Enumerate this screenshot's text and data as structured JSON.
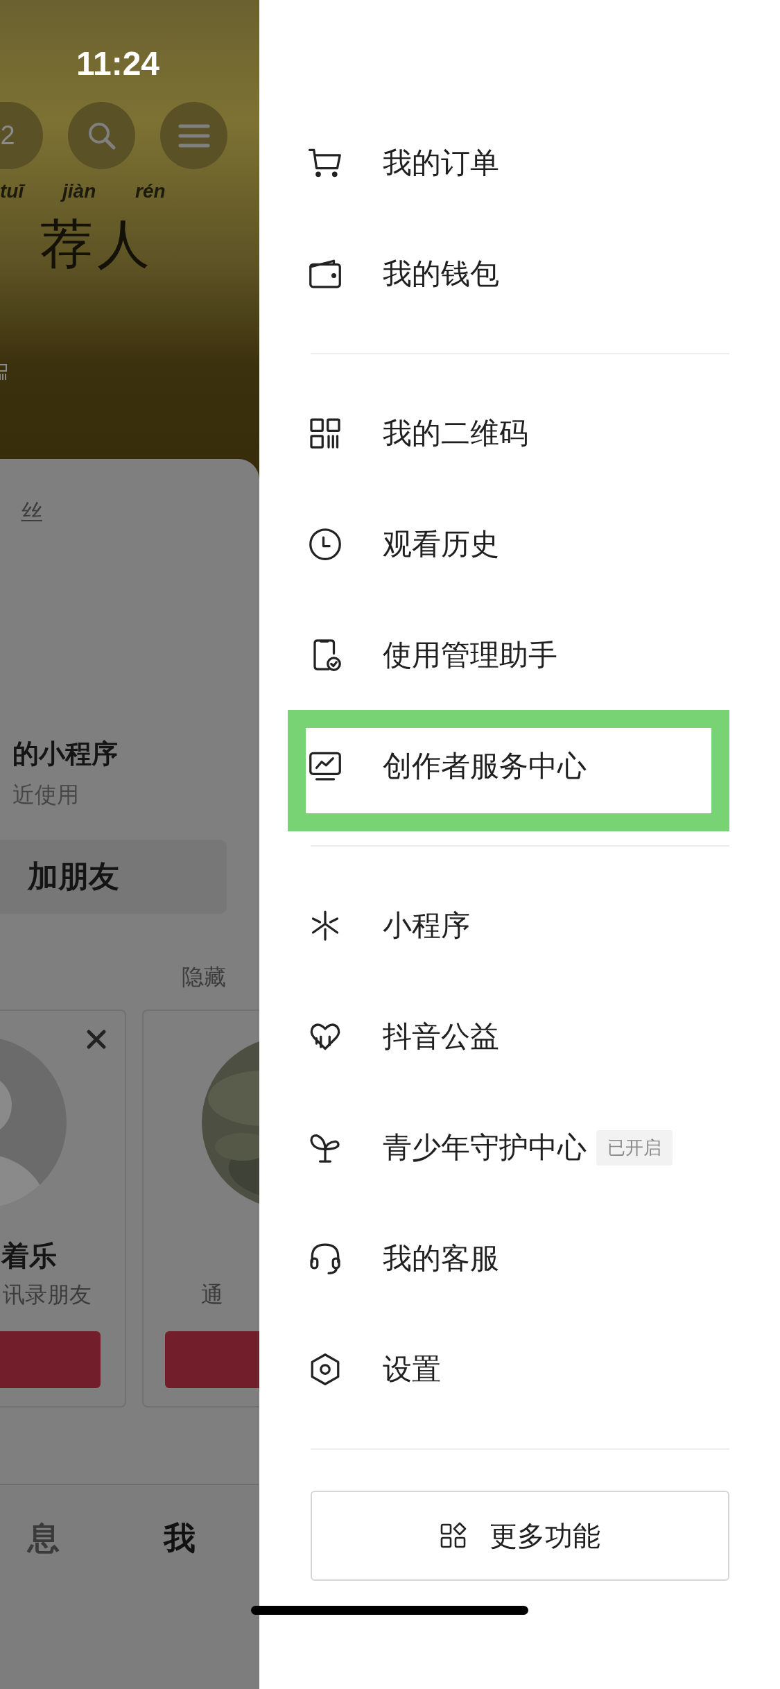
{
  "status_bar": {
    "time": "11:24"
  },
  "background": {
    "header_buttons": [
      {
        "kind": "count",
        "label": "2"
      },
      {
        "kind": "search"
      },
      {
        "kind": "menu"
      }
    ],
    "banner": {
      "pinyin": [
        "tuī",
        "jiàn",
        "rén"
      ],
      "title": "荐人"
    },
    "followers_label": "丝",
    "mini_programs": {
      "title": "的小程序",
      "subtitle": "近使用"
    },
    "add_friend_button": "加朋友",
    "hide_link": "隐藏",
    "suggestions": [
      {
        "kind": "silhouette",
        "name": "着乐",
        "reason": "讯录朋友",
        "dismissible": true
      },
      {
        "kind": "picture",
        "reason": "通",
        "dismissible": false
      }
    ],
    "tabs": [
      {
        "label": "息",
        "selected": false
      },
      {
        "label": "我",
        "selected": true
      }
    ]
  },
  "drawer": {
    "sections": [
      [
        {
          "label": "我的订单",
          "highlighted": false
        },
        {
          "label": "我的钱包",
          "highlighted": false
        }
      ],
      [
        {
          "label": "我的二维码",
          "highlighted": false
        },
        {
          "label": "观看历史",
          "highlighted": false
        },
        {
          "label": "使用管理助手",
          "highlighted": false
        },
        {
          "label": "创作者服务中心",
          "highlighted": true
        }
      ],
      [
        {
          "label": "小程序",
          "highlighted": false
        },
        {
          "label": "抖音公益",
          "highlighted": false
        },
        {
          "label": "青少年守护中心",
          "badge": "已开启",
          "highlighted": false
        },
        {
          "label": "我的客服",
          "highlighted": false
        },
        {
          "label": "设置",
          "highlighted": false
        }
      ]
    ],
    "more_button": "更多功能"
  }
}
